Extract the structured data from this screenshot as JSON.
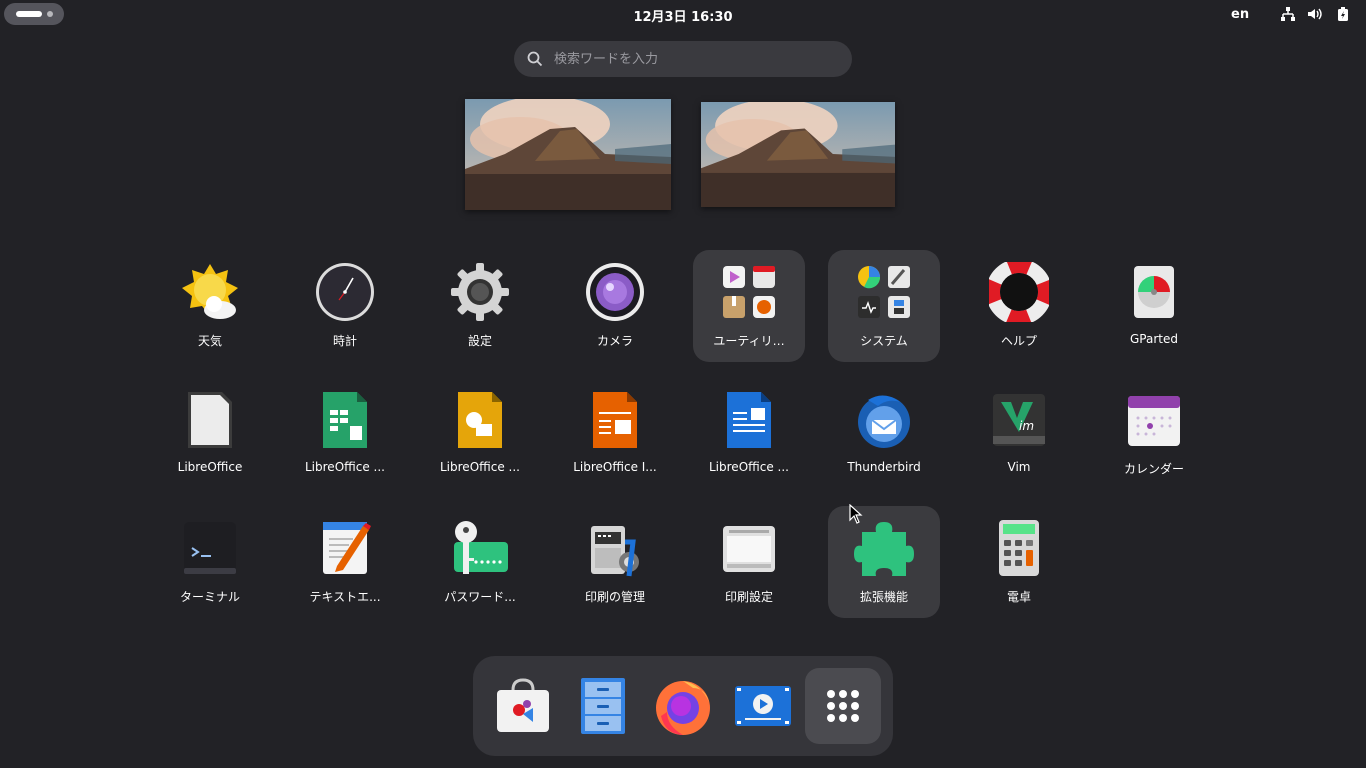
{
  "topbar": {
    "clock": "12月3日  16:30",
    "input_source": "en",
    "tray_icons": [
      "network-icon",
      "volume-icon",
      "battery-icon"
    ]
  },
  "search": {
    "placeholder": "検索ワードを入力",
    "value": ""
  },
  "workspaces": [
    {
      "name": "workspace-1"
    },
    {
      "name": "workspace-2"
    }
  ],
  "apps": [
    {
      "label": "天気",
      "icon": "weather-icon"
    },
    {
      "label": "時計",
      "icon": "clock-icon"
    },
    {
      "label": "設定",
      "icon": "settings-gear-icon"
    },
    {
      "label": "カメラ",
      "icon": "camera-icon"
    },
    {
      "label": "ユーティリ…",
      "icon": "utilities-folder-icon",
      "folder": true
    },
    {
      "label": "システム",
      "icon": "system-folder-icon",
      "folder": true
    },
    {
      "label": "ヘルプ",
      "icon": "lifebuoy-icon"
    },
    {
      "label": "GParted",
      "icon": "disk-icon"
    },
    {
      "label": "LibreOffice",
      "icon": "libreoffice-icon"
    },
    {
      "label": "LibreOffice ...",
      "icon": "libreoffice-calc-icon"
    },
    {
      "label": "LibreOffice ...",
      "icon": "libreoffice-draw-icon"
    },
    {
      "label": "LibreOffice I...",
      "icon": "libreoffice-impress-icon"
    },
    {
      "label": "LibreOffice ...",
      "icon": "libreoffice-writer-icon"
    },
    {
      "label": "Thunderbird",
      "icon": "thunderbird-icon"
    },
    {
      "label": "Vim",
      "icon": "vim-icon"
    },
    {
      "label": "カレンダー",
      "icon": "calendar-icon"
    },
    {
      "label": "ターミナル",
      "icon": "terminal-icon"
    },
    {
      "label": "テキストエ...",
      "icon": "text-editor-icon"
    },
    {
      "label": "パスワード...",
      "icon": "passwords-key-icon"
    },
    {
      "label": "印刷の管理",
      "icon": "print-manager-icon"
    },
    {
      "label": "印刷設定",
      "icon": "printer-icon"
    },
    {
      "label": "拡張機能",
      "icon": "extensions-puzzle-icon",
      "highlighted": true
    },
    {
      "label": "電卓",
      "icon": "calculator-icon"
    }
  ],
  "dash": [
    {
      "icon": "software-store-icon"
    },
    {
      "icon": "files-cabinet-icon"
    },
    {
      "icon": "firefox-icon"
    },
    {
      "icon": "video-player-icon"
    },
    {
      "icon": "show-apps-grid-icon"
    }
  ],
  "colors": {
    "background": "#222226",
    "folder_bg": "#3b3b3f",
    "dash_bg": "#35353a",
    "search_bg": "#3a3a3f"
  }
}
